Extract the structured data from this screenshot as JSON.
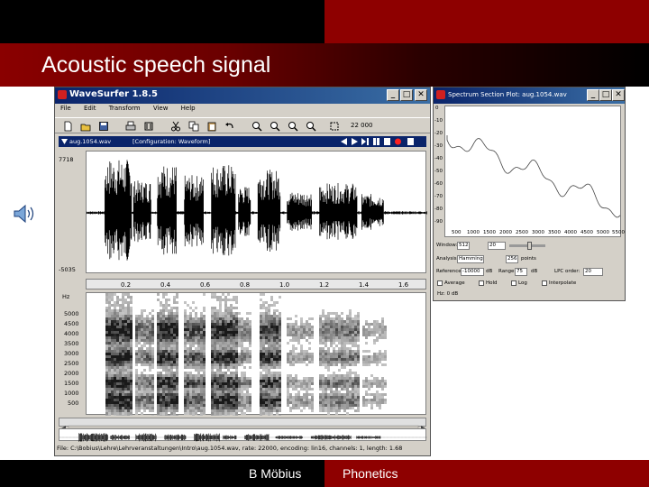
{
  "slide": {
    "title": "Acoustic speech signal",
    "footer_author": "B Möbius",
    "footer_subject": "Phonetics"
  },
  "wavesurfer": {
    "window_title": "WaveSurfer 1.8.5",
    "menus": [
      "File",
      "Edit",
      "Transform",
      "View",
      "Help"
    ],
    "zoom_readout": "22 000",
    "file_name": "aug.1054.wav",
    "configuration": "[Configuration: Waveform]",
    "wave_top": "7718",
    "wave_bottom": "-5035",
    "time_ticks": [
      "0.2",
      "0.4",
      "0.6",
      "0.8",
      "1.0",
      "1.2",
      "1.4",
      "1.6"
    ],
    "hz_label": "Hz",
    "freq_ticks": [
      "5000",
      "4500",
      "4000",
      "3500",
      "3000",
      "2500",
      "2000",
      "1500",
      "1000",
      "500"
    ],
    "status": "File: C:\\Bobius\\Lehre\\Lehrveranstaltungen\\Intro\\aug.1054.wav, rate: 22000, encoding: lin16, channels: 1, length: 1.68"
  },
  "spectrum": {
    "window_title": "Spectrum Section Plot: aug.1054.wav",
    "y_ticks": [
      "0",
      "-10",
      "-20",
      "-30",
      "-40",
      "-50",
      "-60",
      "-70",
      "-80",
      "-90"
    ],
    "x_ticks": [
      "500",
      "1000",
      "1500",
      "2000",
      "2500",
      "3000",
      "3500",
      "4000",
      "4500",
      "5000",
      "5500"
    ],
    "window_label": "Window:",
    "window_value": "512",
    "points_label": "points",
    "reference_label": "Reference:",
    "reference_value": "-10000",
    "range_label": "Range:",
    "range_value": "75",
    "db_unit": "dB",
    "analysis_label": "Analysis:",
    "window_type": "Hamming",
    "fft_points": "256",
    "points_suffix": "points",
    "lpc_label": "LPC order:",
    "lpc_value": "20",
    "check1": "Average",
    "check2": "Hold",
    "check3": "Log",
    "check4": "Interpolate",
    "cursor_readout": "Hz: 0 dB"
  }
}
